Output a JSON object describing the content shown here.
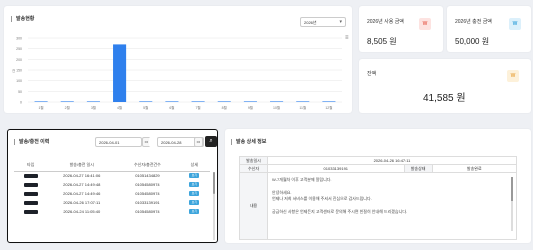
{
  "chart_card": {
    "title": "발송현황",
    "year_select": "2026년",
    "menu_icon": "hamburger-menu-icon"
  },
  "chart_data": {
    "type": "bar",
    "title": "",
    "xlabel": "",
    "ylabel": "건",
    "categories": [
      "1월",
      "2월",
      "3월",
      "4월",
      "5월",
      "6월",
      "7월",
      "8월",
      "9월",
      "10월",
      "11월",
      "12월"
    ],
    "values": [
      0,
      0,
      0,
      270,
      0,
      0,
      0,
      0,
      0,
      0,
      0,
      0
    ],
    "ylim": [
      0,
      300
    ],
    "yticks": [
      0,
      50,
      100,
      150,
      200,
      250,
      300
    ],
    "grid": true,
    "bar_color": "#2f80ed"
  },
  "stats": {
    "monthly_usage": {
      "label": "2026년 사용 금액",
      "value": "8,505 원",
      "badge": "W"
    },
    "monthly_charge": {
      "label": "2026년 충전 금액",
      "value": "50,000 원",
      "badge": "W"
    },
    "balance": {
      "label": "잔액",
      "value": "41,585 원",
      "badge": "W"
    }
  },
  "history": {
    "title": "발송/충전 이력",
    "date_from": "2026-04-01",
    "date_to": "2026-04-28",
    "date_sep": "~",
    "columns": [
      "타입",
      "발송/충전 일시",
      "수신자/충전건수",
      "상세"
    ],
    "rows": [
      {
        "date": "2026-04-27 16:41:06",
        "target": "01051434829",
        "detail": "보기"
      },
      {
        "date": "2026-04-27 14:49:48",
        "target": "01054580974",
        "detail": "보기"
      },
      {
        "date": "2026-04-27 14:49:46",
        "target": "01054580974",
        "detail": "보기"
      },
      {
        "date": "2026-04-26 17:07:11",
        "target": "01033139191",
        "detail": "보기"
      },
      {
        "date": "2026-04-24 11:05:40",
        "target": "01054580974",
        "detail": "보기"
      }
    ]
  },
  "detail": {
    "title": "발송 상세 정보",
    "sent_at_label": "발송일시",
    "sent_at": "2026-04-26 16:47:11",
    "receiver_label": "수신자",
    "receiver": "01033139191",
    "status_label": "발송상태",
    "status": "발송완료",
    "content_label": "내용",
    "content_lines": [
      "W-7개월차 이후 고객분께 알립니다.",
      "",
      "안녕하세요.",
      "언제나 저희 서비스를 이용해 주셔서 진심으로 감사드립니다.",
      "",
      "궁금하신 사항은 언제든지 고객센터로 문의해 주시면 친절히 안내해 드리겠습니다."
    ]
  }
}
